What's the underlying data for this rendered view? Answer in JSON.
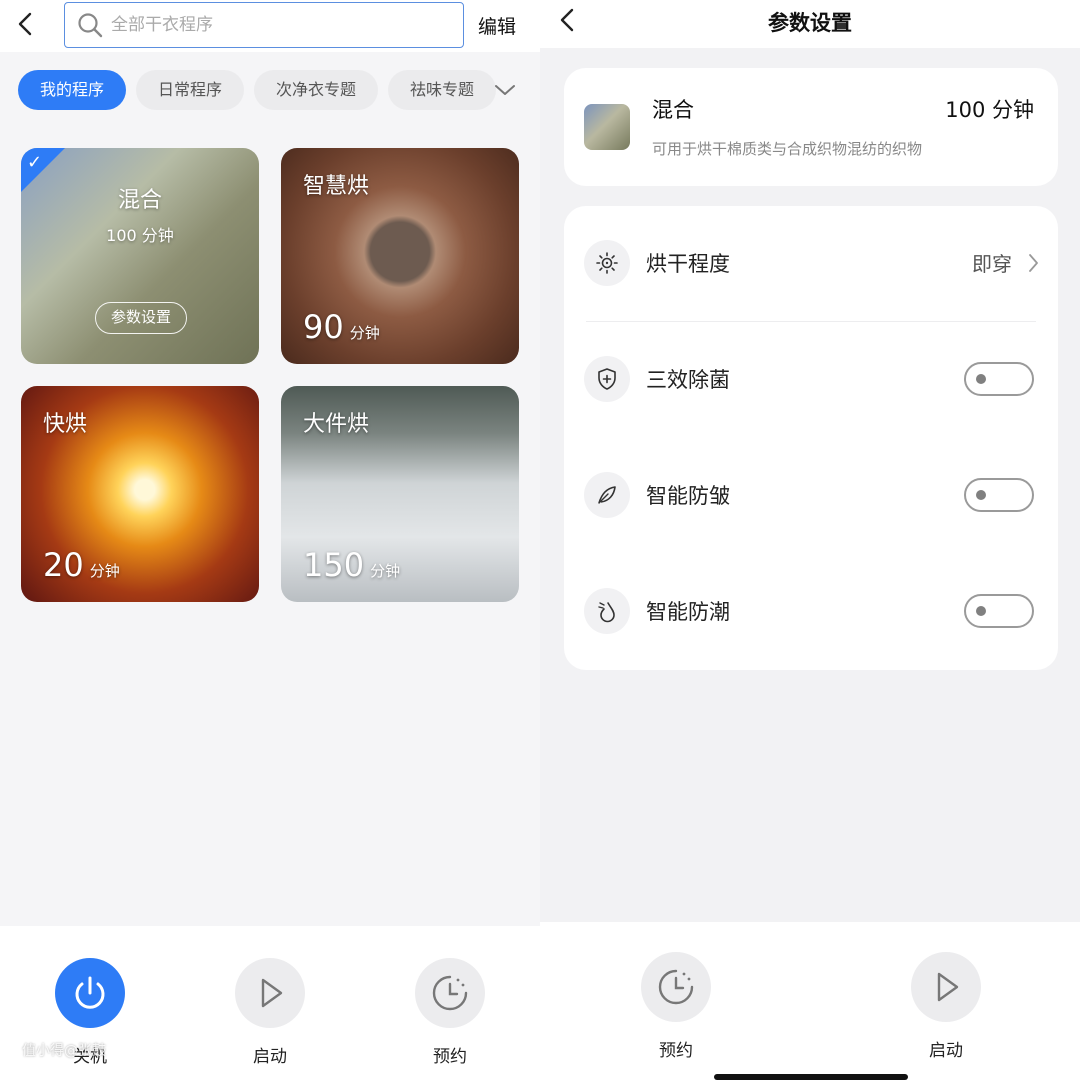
{
  "left": {
    "search": {
      "placeholder": "全部干衣程序"
    },
    "edit_label": "编辑",
    "chips": [
      {
        "label": "我的程序",
        "active": true
      },
      {
        "label": "日常程序",
        "active": false
      },
      {
        "label": "次净衣专题",
        "active": false
      },
      {
        "label": "祛味专题",
        "active": false
      }
    ],
    "cards": [
      {
        "title": "混合",
        "duration": "100 分钟",
        "selected": true,
        "param_label": "参数设置"
      },
      {
        "title": "智慧烘",
        "minutes": "90",
        "unit": "分钟"
      },
      {
        "title": "快烘",
        "minutes": "20",
        "unit": "分钟"
      },
      {
        "title": "大件烘",
        "minutes": "150",
        "unit": "分钟"
      }
    ],
    "bottom": {
      "power_label": "关机",
      "start_label": "启动",
      "schedule_label": "预约"
    },
    "watermark": "值小得@张鼓"
  },
  "right": {
    "title": "参数设置",
    "program": {
      "name": "混合",
      "duration": "100 分钟",
      "description": "可用于烘干棉质类与合成织物混纺的织物"
    },
    "options": [
      {
        "label": "烘干程度",
        "value": "即穿",
        "icon": "sun-icon"
      },
      {
        "label": "三效除菌",
        "toggle": false,
        "icon": "shield-plus-icon"
      },
      {
        "label": "智能防皱",
        "toggle": false,
        "icon": "feather-icon"
      },
      {
        "label": "智能防潮",
        "toggle": false,
        "icon": "droplet-icon"
      }
    ],
    "bottom": {
      "schedule_label": "预约",
      "start_label": "启动"
    }
  },
  "colors": {
    "accent": "#2e7cf6",
    "background": "#f5f5f7",
    "toggle_off": "#9a9a9a"
  }
}
